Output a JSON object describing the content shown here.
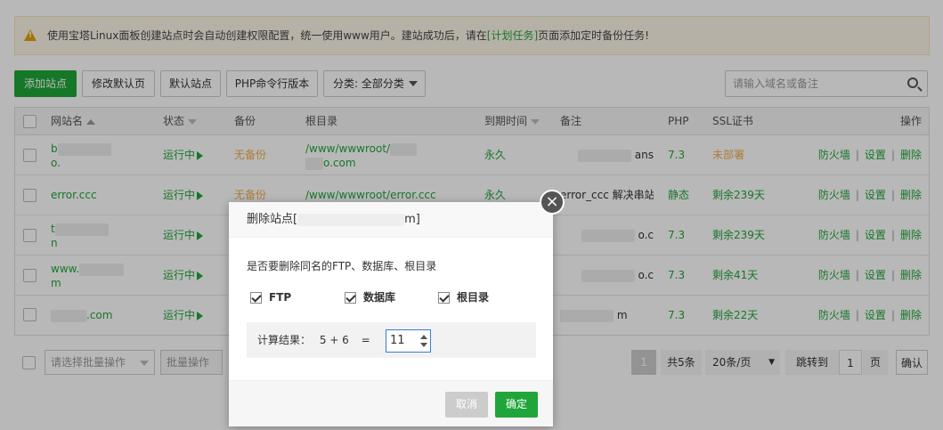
{
  "notice": {
    "prefix": "使用宝塔Linux面板创建站点时会自动创建权限配置，统一使用www用户。建站成功后，请在",
    "link": "[计划任务]",
    "suffix": "页面添加定时备份任务!"
  },
  "toolbar": {
    "add_site": "添加站点",
    "modify_default_page": "修改默认页",
    "default_site": "默认站点",
    "php_cli_version": "PHP命令行版本",
    "category": "分类: 全部分类"
  },
  "search": {
    "placeholder": "请输入域名或备注"
  },
  "table": {
    "headers": {
      "name": "网站名",
      "status": "状态",
      "backup": "备份",
      "root": "根目录",
      "expire": "到期时间",
      "remark": "备注",
      "php": "PHP",
      "ssl": "SSL证书",
      "ops": "操作"
    },
    "rows": [
      {
        "name": "b",
        "name2": "o.",
        "status": "运行中",
        "backup": "无备份",
        "root": "/www/wwwroot/",
        "root2": "o.com",
        "expire": "永久",
        "remark": "ans",
        "php": "7.3",
        "ssl": "未部署"
      },
      {
        "name": "error.ccc",
        "name2": "",
        "status": "运行中",
        "backup": "无备份",
        "root": "/www/wwwroot/error.ccc",
        "root2": "",
        "expire": "永久",
        "remark": "error_ccc 解决串站",
        "php": "静态",
        "ssl": "剩余239天"
      },
      {
        "name": "t",
        "name2": "n",
        "status": "运行中",
        "backup": "",
        "root": "",
        "root2": "",
        "expire": "",
        "remark": "o.c",
        "php": "7.3",
        "ssl": "剩余239天"
      },
      {
        "name": "www.",
        "name2": "m",
        "status": "运行中",
        "backup": "",
        "root": "",
        "root2": "",
        "expire": "",
        "remark": "o.c",
        "php": "7.3",
        "ssl": "剩余41天"
      },
      {
        "name": ".com",
        "name2": "",
        "status": "运行中",
        "backup": "",
        "root": "",
        "root2": "",
        "expire": "",
        "remark": "m",
        "php": "7.3",
        "ssl": "剩余22天"
      }
    ],
    "ops": {
      "firewall": "防火墙",
      "settings": "设置",
      "delete": "删除"
    }
  },
  "bottom": {
    "batch_placeholder": "请选择批量操作",
    "batch_button": "批量操作",
    "page": "1",
    "total": "共5条",
    "per_page": "20条/页",
    "jump_label": "跳转到",
    "jump_value": "1",
    "page_unit": "页",
    "confirm": "确认"
  },
  "dialog": {
    "title": "删除站点[",
    "title_end": "m]",
    "question": "是否要删除同名的FTP、数据库、根目录",
    "options": {
      "ftp": "FTP",
      "database": "数据库",
      "root": "根目录"
    },
    "calc_label": "计算结果：",
    "expression": "5 + 6",
    "equals": "=",
    "answer": "11",
    "cancel": "取消",
    "confirm": "确定"
  },
  "colors": {
    "accent": "#20a53a",
    "warning": "#f0ad4e"
  }
}
